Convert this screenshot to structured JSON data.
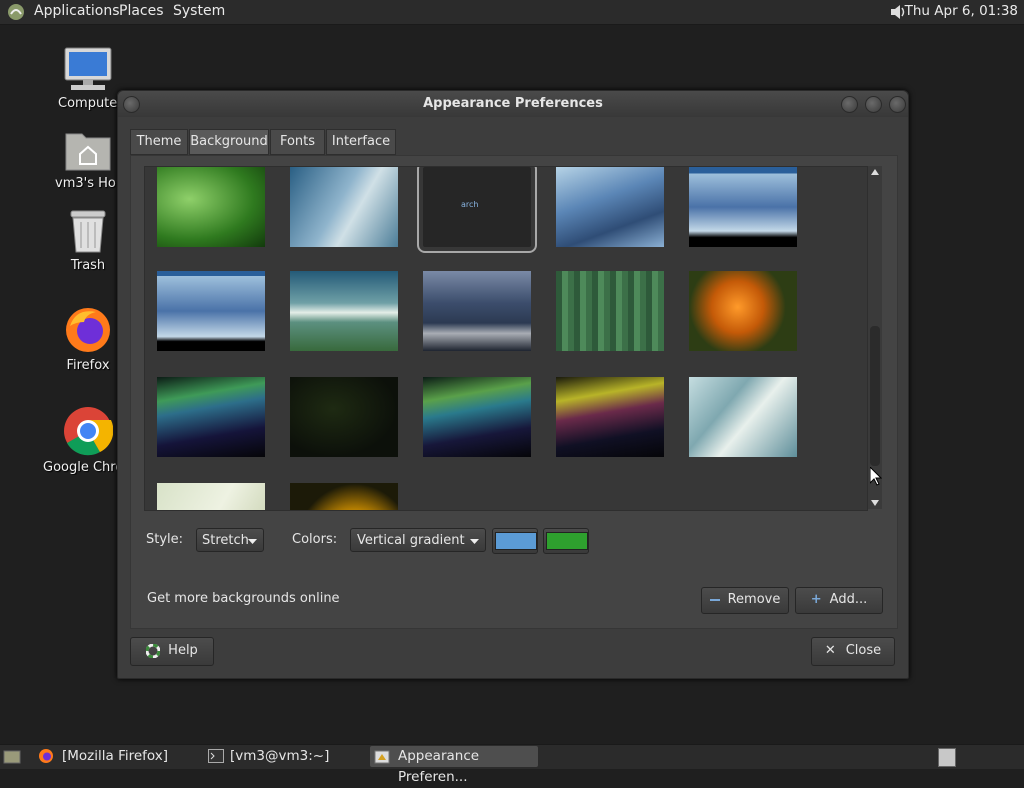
{
  "top_panel": {
    "menus": [
      "Applications",
      "Places",
      "System"
    ],
    "clock": "Thu Apr  6, 01:38"
  },
  "desktop": {
    "icons": [
      {
        "label": "Computer",
        "icon": "computer-icon"
      },
      {
        "label": "vm3's Home",
        "icon": "home-folder-icon"
      },
      {
        "label": "Trash",
        "icon": "trash-icon"
      },
      {
        "label": "Firefox",
        "icon": "firefox-icon"
      },
      {
        "label": "Google Chrome",
        "icon": "chrome-icon"
      }
    ]
  },
  "window": {
    "title": "Appearance Preferences",
    "tabs": [
      "Theme",
      "Background",
      "Fonts",
      "Interface"
    ],
    "active_tab": "Background",
    "thumbnails": [
      {
        "name": "green-leaf"
      },
      {
        "name": "blue-waves"
      },
      {
        "name": "arch-dark",
        "text": "arch"
      },
      {
        "name": "abstract-blue"
      },
      {
        "name": "abstract-blue-letterbox"
      },
      {
        "name": "abstract-blue-2"
      },
      {
        "name": "green-blue-horizon"
      },
      {
        "name": "storm-sky"
      },
      {
        "name": "green-stripes"
      },
      {
        "name": "orange-flower"
      },
      {
        "name": "aurora-1"
      },
      {
        "name": "dark-green"
      },
      {
        "name": "aurora-2"
      },
      {
        "name": "aurora-3"
      },
      {
        "name": "blue-waves-2"
      },
      {
        "name": "pale-green"
      },
      {
        "name": "yellow-flower"
      }
    ],
    "selected_thumbnail": 2,
    "style_label": "Style:",
    "style_value": "Stretch",
    "colors_label": "Colors:",
    "colors_value": "Vertical gradient",
    "color1": "#5b9bd5",
    "color2": "#2ea02e",
    "more_online": "Get more backgrounds online",
    "remove_label": "Remove",
    "add_label": "Add...",
    "help_label": "Help",
    "close_label": "Close"
  },
  "taskbar": {
    "items": [
      {
        "label": "[Mozilla Firefox]"
      },
      {
        "label": "[vm3@vm3:~]"
      },
      {
        "label": "Appearance Preferen..."
      }
    ]
  }
}
